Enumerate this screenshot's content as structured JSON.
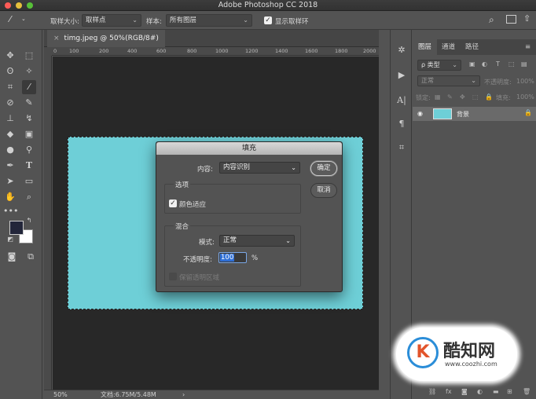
{
  "app": {
    "title": "Adobe Photoshop CC 2018"
  },
  "options": {
    "sample_size_label": "取样大小:",
    "sample_size_value": "取样点",
    "sample_label": "样本:",
    "sample_value": "所有图层",
    "show_ring_label": "显示取样环"
  },
  "document": {
    "tab_title": "timg.jpeg @ 50%(RGB/8#)",
    "ruler_ticks": [
      "0",
      "100",
      "200",
      "400",
      "600",
      "800",
      "1000",
      "1200",
      "1400",
      "1600",
      "1800",
      "2000"
    ],
    "zoom": "50%",
    "doc_info": "文档:6.75M/5.48M",
    "image_color": "#6ecfd7"
  },
  "dialog": {
    "title": "填充",
    "content_label": "内容:",
    "content_value": "内容识别",
    "ok_label": "确定",
    "cancel_label": "取消",
    "options_title": "选项",
    "color_adapt_label": "颜色适应",
    "blend_title": "混合",
    "mode_label": "模式:",
    "mode_value": "正常",
    "opacity_label": "不透明度:",
    "opacity_value": "100",
    "opacity_unit": "%",
    "preserve_label": "保留透明区域"
  },
  "panels": {
    "tabs": [
      "图层",
      "通道",
      "路径"
    ],
    "filter_label": "ρ 类型",
    "blend_mode": "正常",
    "opacity_label": "不透明度:",
    "opacity_value": "100%",
    "lock_label": "锁定:",
    "fill_label": "填充:",
    "fill_value": "100%",
    "layer_name": "背景"
  },
  "watermark": {
    "name": "酷知网",
    "url": "www.coozhi.com",
    "logo_letter": "K"
  }
}
